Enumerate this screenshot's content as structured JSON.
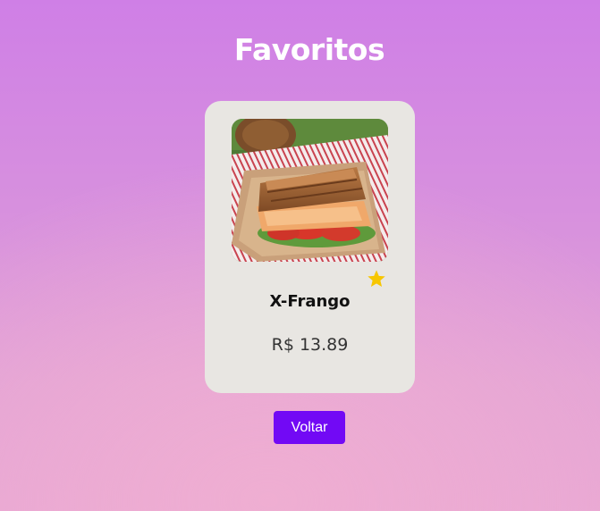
{
  "page": {
    "title": "Favoritos"
  },
  "favorites": [
    {
      "name": "X-Frango",
      "price": "R$ 13.89",
      "image_icon": "chicken-sandwich-photo",
      "favorite_icon": "star-icon",
      "is_favorite": true
    }
  ],
  "actions": {
    "back_label": "Voltar"
  },
  "colors": {
    "background_top": "#cf7fe6",
    "background_bottom": "#e8a7d4",
    "card_background": "#e8e6e2",
    "star": "#f7c600",
    "button": "#7209f5",
    "button_text": "#ffffff",
    "title_text": "#ffffff"
  }
}
